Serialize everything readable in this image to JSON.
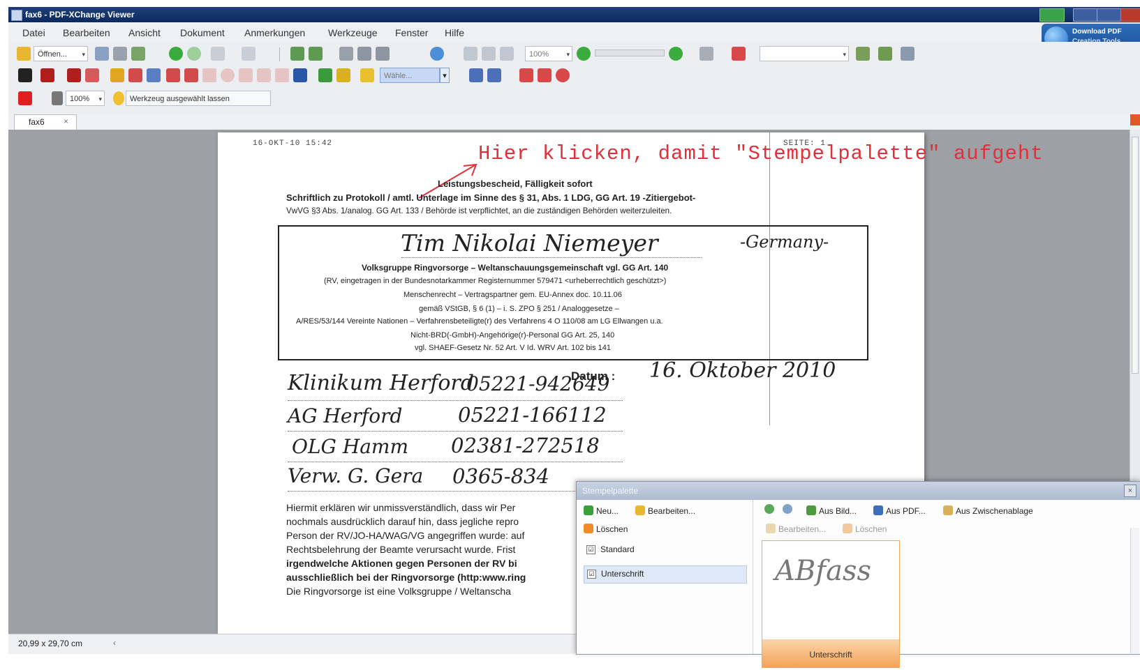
{
  "window": {
    "title": "fax6 - PDF-XChange Viewer"
  },
  "menu": [
    "Datei",
    "Bearbeiten",
    "Ansicht",
    "Dokument",
    "Anmerkungen",
    "Werkzeuge",
    "Fenster",
    "Hilfe"
  ],
  "toolbar": {
    "open_label": "Öffnen...",
    "zoom_value": "100%",
    "search_value": "",
    "font_combo": "Wähle...",
    "opacity_value": "100%",
    "tool_hint": "Werkzeug ausgewählt lassen"
  },
  "promo": {
    "line1": "Download PDF",
    "line2": "Creation Tools"
  },
  "tab": {
    "label": "fax6",
    "close": "×"
  },
  "page": {
    "fax_left": "16-OKT-10 15:42",
    "fax_right": "SEITE:   1",
    "annotation": "Hier klicken, damit \"Stempelpalette\" aufgeht",
    "heading": "Leistungsbescheid, Fälligkeit sofort",
    "line2": "Schriftlich zu Protokoll / amtl. Unterlage im Sinne des § 31, Abs. 1 LDG, GG Art. 19 -Zitiergebot-",
    "line3": "VwVG §3 Abs. 1/analog. GG Art. 133 / Behörde ist verpflichtet, an die zuständigen Behörden weiterzuleiten.",
    "box_name": "Tim Nikolai Niemeyer",
    "box_country": "-Germany-",
    "box_lines": [
      "Volksgruppe Ringvorsorge – Weltanschauungsgemeinschaft vgl. GG Art. 140",
      "(RV, eingetragen in der Bundesnotarkammer Registernummer 579471 <urheberrechtlich geschützt>)",
      "Menschenrecht – Vertragspartner gem. EU-Annex doc. 10.11.06",
      "gemäß VStGB, § 6 (1) – i. S. ZPO § 251 / Analoggesetze –",
      "A/RES/53/144 Vereinte Nationen – Verfahrensbeteiligte(r) des Verfahrens 4 O 110/08 am LG Ellwangen u.a.",
      "Nicht-BRD(-GmbH)-Angehörige(r)-Personal  GG Art. 25, 140",
      "vgl. SHAEF-Gesetz Nr. 52 Art. V Id. WRV Art. 102 bis 141"
    ],
    "datum_label": "Datum :",
    "datum_value": "16. Oktober 2010",
    "contacts": [
      {
        "name": "Klinikum Herford",
        "phone": "05221-942649"
      },
      {
        "name": "AG Herford",
        "phone": "05221-166112"
      },
      {
        "name": "OLG Hamm",
        "phone": "02381-272518"
      },
      {
        "name": "Verw. G. Gera",
        "phone": "0365-834"
      }
    ],
    "body_lines": [
      "Hiermit erklären wir unmissverständlich, dass wir Per",
      "nochmals ausdrücklich darauf hin, dass jegliche repro",
      "Person der RV/JO-HA/WAG/VG angegriffen wurde: auf",
      "Rechtsbelehrung der Beamte verursacht wurde. Frist",
      "irgendwelche Aktionen gegen Personen der RV bi",
      "ausschließlich bei der Ringvorsorge (http:www.ring",
      "Die Ringvorsorge ist eine Volksgruppe / Weltanscha"
    ]
  },
  "statusbar": {
    "dimensions": "20,99 x 29,70 cm",
    "spin": "‹"
  },
  "palette": {
    "title": "Stempelpalette",
    "close": "×",
    "left_buttons": [
      "Neu...",
      "Bearbeiten...",
      "Löschen"
    ],
    "right_buttons": [
      "Aus Bild...",
      "Aus PDF...",
      "Aus Zwischenablage"
    ],
    "right_buttons_dim": [
      "Bearbeiten...",
      "Löschen"
    ],
    "collections": [
      {
        "label": "Standard",
        "checked": "☑"
      },
      {
        "label": "Unterschrift",
        "checked": "☑"
      }
    ],
    "stamp_caption": "Unterschrift",
    "stamp_sig": "ABfass"
  },
  "colors": {
    "annotation": "#e0303a",
    "titlebar": "#0b2a5e",
    "stamp_orange": "#f4a25a"
  }
}
